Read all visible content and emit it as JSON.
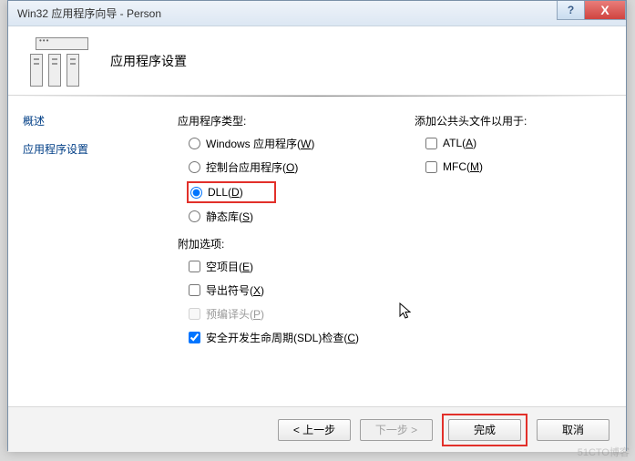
{
  "window": {
    "title": "Win32 应用程序向导 - Person",
    "help_label": "?",
    "close_label": "X"
  },
  "header": {
    "title": "应用程序设置"
  },
  "sidebar": {
    "items": [
      {
        "label": "概述"
      },
      {
        "label": "应用程序设置"
      }
    ]
  },
  "main": {
    "app_type_label": "应用程序类型:",
    "radios": [
      {
        "label": "Windows 应用程序(",
        "accel": "W",
        "tail": ")",
        "checked": false
      },
      {
        "label": "控制台应用程序(",
        "accel": "O",
        "tail": ")",
        "checked": false
      },
      {
        "label": "DLL(",
        "accel": "D",
        "tail": ")",
        "checked": true
      },
      {
        "label": "静态库(",
        "accel": "S",
        "tail": ")",
        "checked": false
      }
    ],
    "addl_opts_label": "附加选项:",
    "checks": [
      {
        "label": "空项目(",
        "accel": "E",
        "tail": ")",
        "checked": false,
        "disabled": false
      },
      {
        "label": "导出符号(",
        "accel": "X",
        "tail": ")",
        "checked": false,
        "disabled": false
      },
      {
        "label": "预编译头(",
        "accel": "P",
        "tail": ")",
        "checked": false,
        "disabled": true
      },
      {
        "label": "安全开发生命周期(SDL)检查(",
        "accel": "C",
        "tail": ")",
        "checked": true,
        "disabled": false
      }
    ],
    "headers_label": "添加公共头文件以用于:",
    "header_checks": [
      {
        "label": "ATL(",
        "accel": "A",
        "tail": ")",
        "checked": false
      },
      {
        "label": "MFC(",
        "accel": "M",
        "tail": ")",
        "checked": false
      }
    ]
  },
  "footer": {
    "prev": "< 上一步",
    "next": "下一步 >",
    "finish": "完成",
    "cancel": "取消"
  },
  "watermark": "51CTO博客"
}
